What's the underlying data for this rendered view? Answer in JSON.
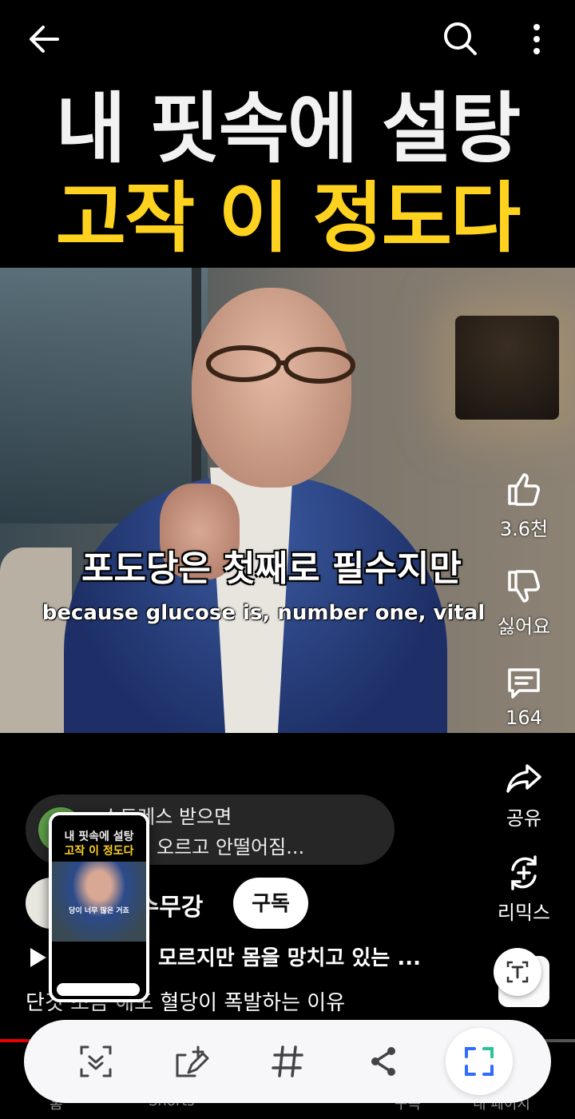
{
  "top_bar": {
    "back_icon": "arrow-left-icon",
    "search_icon": "search-icon",
    "more_icon": "more-vert-icon"
  },
  "headline": {
    "line1": "내 핏속에 설탕",
    "line2": "고작 이 정도다"
  },
  "subtitles": {
    "korean": "포도당은 첫째로 필수지만",
    "english": "because glucose is, number one, vital"
  },
  "actions": {
    "like_count": "3.6천",
    "dislike_label": "싫어요",
    "comment_count": "164",
    "share_label": "공유",
    "remix_label": "리믹스"
  },
  "comment_preview": {
    "line1": "스트레스 받으면",
    "line2": "오르고 안떨어짐..."
  },
  "channel": {
    "name": "안수무강",
    "subscribe_label": "구독"
  },
  "playlist": {
    "title": "모르지만 몸을 망치고 있는 ..."
  },
  "description": "단것 조금 해도 혈당이 폭발하는 이유",
  "progress": {
    "fraction": 0.05
  },
  "bottom_nav": {
    "home": "홈",
    "shorts": "Shorts",
    "subs": "구독",
    "my": "내 페이지"
  },
  "thumbnail": {
    "line1": "내 핏속에 설탕",
    "line2": "고작 이 정도다",
    "subtitle": "당이 너무 많은 거죠"
  },
  "colors": {
    "accent_yellow": "#ffd21f",
    "progress_red": "#e00000",
    "toolbar_blue": "#2f6bff"
  }
}
